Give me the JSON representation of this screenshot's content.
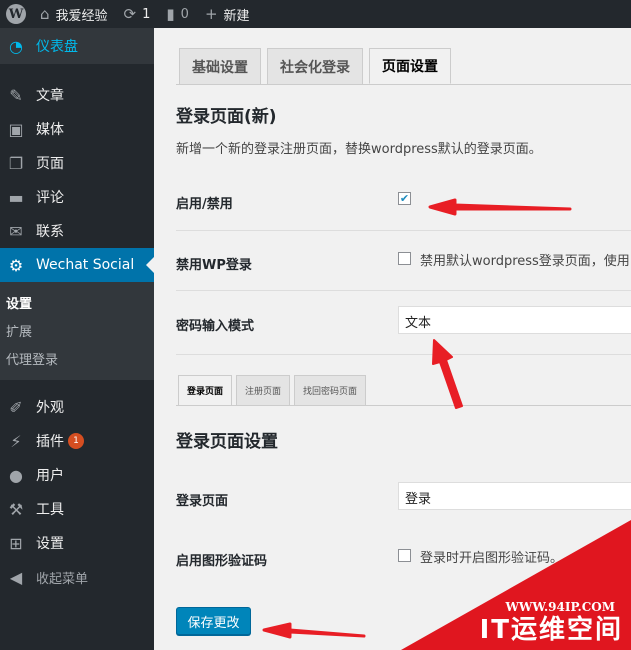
{
  "adminbar": {
    "site_name": "我爱经验",
    "updates_count": "1",
    "comments_count": "0",
    "new_label": "新建"
  },
  "sidebar": {
    "dashboard": "仪表盘",
    "items_top": [
      {
        "label": "文章",
        "icon": "pin-icon"
      },
      {
        "label": "媒体",
        "icon": "media-icon"
      },
      {
        "label": "页面",
        "icon": "page-icon"
      },
      {
        "label": "评论",
        "icon": "comment-icon"
      },
      {
        "label": "联系",
        "icon": "mail-icon"
      }
    ],
    "active": {
      "label": "Wechat Social",
      "icon": "gear-icon"
    },
    "submenu": [
      "设置",
      "扩展",
      "代理登录"
    ],
    "items_bottom": [
      {
        "label": "外观",
        "icon": "brush-icon"
      },
      {
        "label": "插件",
        "icon": "plugin-icon",
        "badge": "1"
      },
      {
        "label": "用户",
        "icon": "user-icon"
      },
      {
        "label": "工具",
        "icon": "wrench-icon"
      },
      {
        "label": "设置",
        "icon": "settings-icon"
      }
    ],
    "collapse": "收起菜单"
  },
  "main": {
    "tabs": [
      "基础设置",
      "社会化登录",
      "页面设置"
    ],
    "active_tab": "页面设置",
    "section_title": "登录页面(新)",
    "section_desc": "新增一个新的登录注册页面，替换wordpress默认的登录页面。",
    "rows": {
      "enable_label": "启用/禁用",
      "enable_checked": true,
      "disable_wp_label": "禁用WP登录",
      "disable_wp_text": "禁用默认wordpress登录页面，使用",
      "password_mode_label": "密码输入模式",
      "password_mode_value": "文本"
    },
    "subtabs": [
      "登录页面",
      "注册页面",
      "找回密码页面"
    ],
    "login_settings_title": "登录页面设置",
    "login_page_label": "登录页面",
    "login_page_value": "登录",
    "captcha_label": "启用图形验证码",
    "captcha_text": "登录时开启图形验证码。",
    "save_button": "保存更改"
  },
  "watermark": {
    "url": "WWW.94IP.COM",
    "brand": "IT运维空间",
    "color": "#e0161f"
  },
  "colors": {
    "adminbar": "#23282d",
    "active_menu": "#0073aa",
    "dashboard_text": "#00b9eb",
    "annotation_arrow": "#e81e25"
  }
}
